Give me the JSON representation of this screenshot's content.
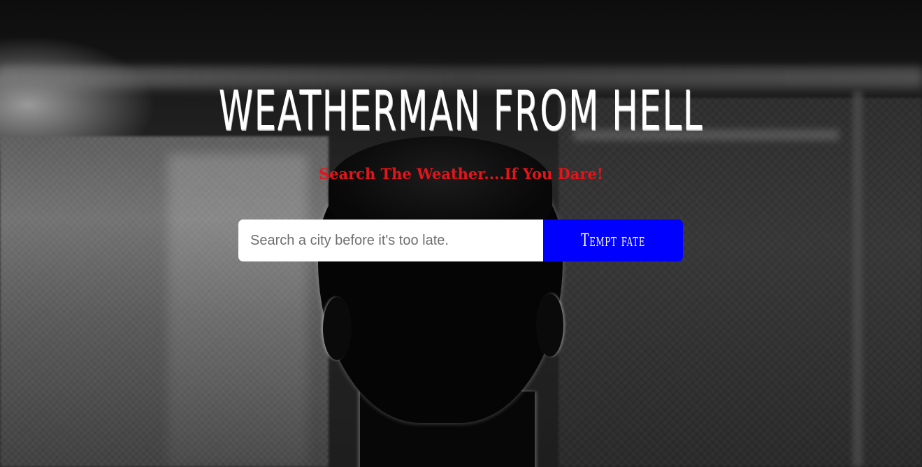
{
  "header": {
    "title": "WEATHERMAN FROM HELL",
    "subtitle": "Search The Weather....If You Dare!"
  },
  "search": {
    "placeholder": "Search a city before it's too late.",
    "value": "",
    "button_label": "Tempt fate"
  },
  "colors": {
    "title": "#ffffff",
    "subtitle": "#e3151a",
    "button_background": "#0000ff",
    "button_text": "#ffffff",
    "input_background": "#ffffff",
    "page_background": "#1e1e1e"
  }
}
